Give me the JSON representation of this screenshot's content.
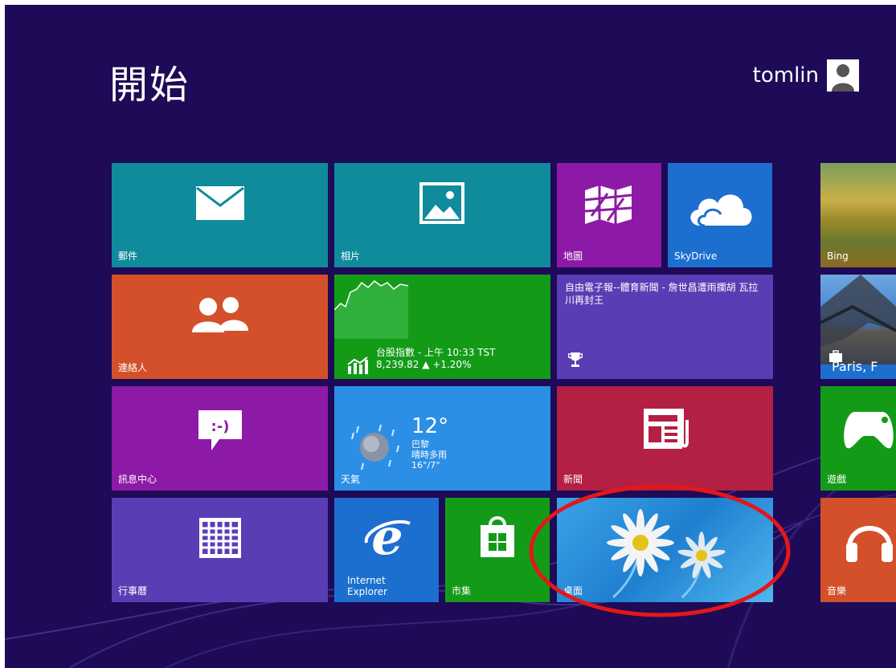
{
  "start": {
    "title": "開始"
  },
  "user": {
    "name": "tomlin"
  },
  "tiles": {
    "mail": {
      "label": "郵件"
    },
    "photos": {
      "label": "相片"
    },
    "maps": {
      "label": "地圖"
    },
    "skydrive": {
      "label": "SkyDrive"
    },
    "bing": {
      "label": "Bing"
    },
    "people": {
      "label": "連絡人"
    },
    "finance": {
      "headline": "台股指數 - 上午 10:33 TST",
      "value": "8,239.82 ▲ +1.20%"
    },
    "sports": {
      "headline": "自由電子報--體育新聞 - 詹世昌遭雨攔胡 瓦拉川再封王"
    },
    "travel": {
      "caption": "Paris, F"
    },
    "messaging": {
      "label": "訊息中心"
    },
    "weather": {
      "label": "天氣",
      "temp": "12°",
      "city": "巴黎",
      "condition": "晴時多雨",
      "range": "16°/7°"
    },
    "news": {
      "label": "新聞"
    },
    "games": {
      "label": "遊戲"
    },
    "calendar": {
      "label": "行事曆"
    },
    "ie": {
      "label_line1": "Internet",
      "label_line2": "Explorer"
    },
    "store": {
      "label": "市集"
    },
    "desktop": {
      "label": "桌面"
    },
    "music": {
      "label": "音樂"
    }
  },
  "colors": {
    "background": "#1e0a56",
    "teal": "#0f8b9b",
    "purple": "#8d1aa6",
    "blue": "#1c6fcf",
    "orange": "#d4502a",
    "green": "#139b18",
    "violet": "#5a3db5",
    "crimson": "#b41f44",
    "highlight_circle": "#e3171a"
  }
}
